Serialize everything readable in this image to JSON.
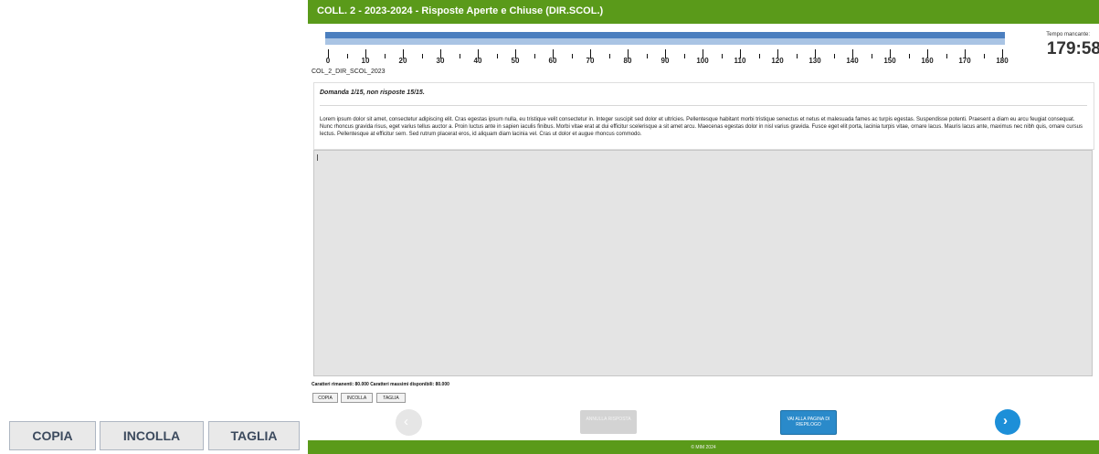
{
  "header": {
    "title": "COLL. 2 - 2023-2024 - Risposte Aperte e Chiuse (DIR.SCOL.)"
  },
  "timer": {
    "label": "Tempo mancante:",
    "value": "179:58",
    "ticks": [
      "0",
      "10",
      "20",
      "30",
      "40",
      "50",
      "60",
      "70",
      "80",
      "90",
      "100",
      "110",
      "120",
      "130",
      "140",
      "150",
      "160",
      "170",
      "180"
    ],
    "max": 180,
    "colors": {
      "bar": "#4b7fbf",
      "bar_light": "#a9c4e4"
    }
  },
  "exam_code": "COL_2_DIR_SCOL_2023",
  "question": {
    "header": "Domanda 1/15, non risposte 15/15.",
    "text": "Lorem ipsum dolor sit amet, consectetur adipiscing elit. Cras egestas ipsum nulla, eu tristique velit consectetur in. Integer suscipit sed dolor et ultricies. Pellentesque habitant morbi tristique senectus et netus et malesuada fames ac turpis egestas. Suspendisse potenti. Praesent a diam eu arcu feugiat consequat. Nunc rhoncus gravida risus, eget varius tellus auctor a. Proin luctus ante in sapien iaculis finibus. Morbi vitae erat at dui efficitur scelerisque a sit amet arcu. Maecenas egestas dolor in nisl varius gravida. Fusce eget elit porta, lacinia turpis vitae, ornare lacus. Mauris lacus ante, maximus nec nibh quis, ornare cursus lectus. Pellentesque at efficitur sem. Sed rutrum placerat eros, id aliquam diam lacinia vel. Cras ut dolor et augue rhoncus commodo."
  },
  "answer": {
    "value": ""
  },
  "counter": {
    "text": "Caratteri rimanenti: 80.000   Caratteri massimi disponibili: 80.000"
  },
  "edit_buttons": {
    "copy": "COPIA",
    "paste": "INCOLLA",
    "cut": "TAGLIA"
  },
  "nav": {
    "prev_icon": "chevron-left-icon",
    "next_icon": "chevron-right-icon",
    "disabled_label": "ANNULLA RISPOSTA",
    "summary_label": "VAI ALLA PAGINA DI RIEPILOGO"
  },
  "footer": {
    "text": "© MIM 2024"
  },
  "colors": {
    "header": "#5a9a1a",
    "summary": "#2a8aca",
    "next": "#1d8fd8"
  }
}
